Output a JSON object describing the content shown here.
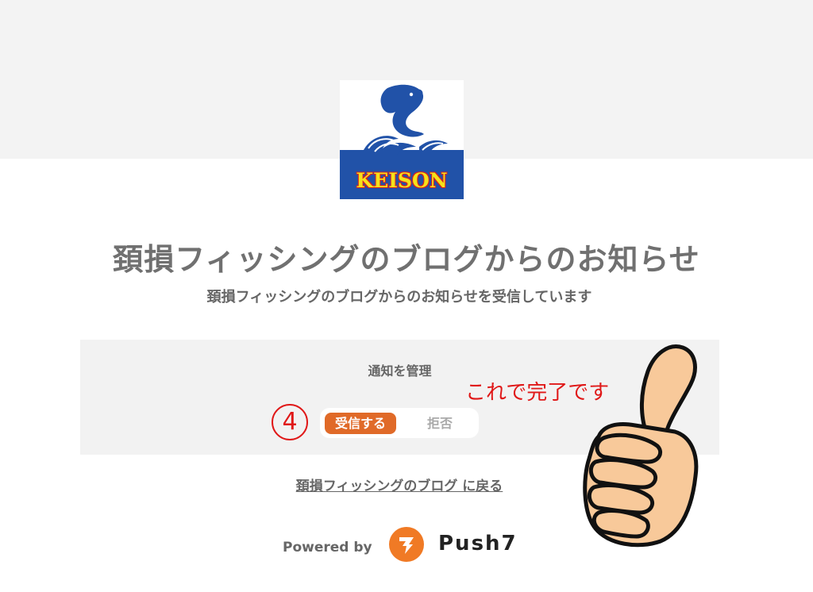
{
  "header": {
    "logo_text": "KEISON"
  },
  "main": {
    "title": "頚損フィッシングのブログからのお知らせ",
    "subtitle": "頚損フィッシングのブログからのお知らせを受信しています"
  },
  "manage": {
    "label": "通知を管理",
    "accept_label": "受信する",
    "reject_label": "拒否",
    "selected": "受信する"
  },
  "annotation": {
    "step_number": "4",
    "note": "これで完了です",
    "icon": "thumbs-up-icon"
  },
  "back_link": {
    "label": "頚損フィッシングのブログ に戻る"
  },
  "footer": {
    "powered_by": "Powered by",
    "brand_name": "Push7",
    "brand_icon": "push7-logo-icon"
  },
  "colors": {
    "accent": "#e06a28",
    "annotation_red": "#e01818",
    "logo_blue": "#2152a8",
    "logo_yellow": "#f5e21a"
  }
}
